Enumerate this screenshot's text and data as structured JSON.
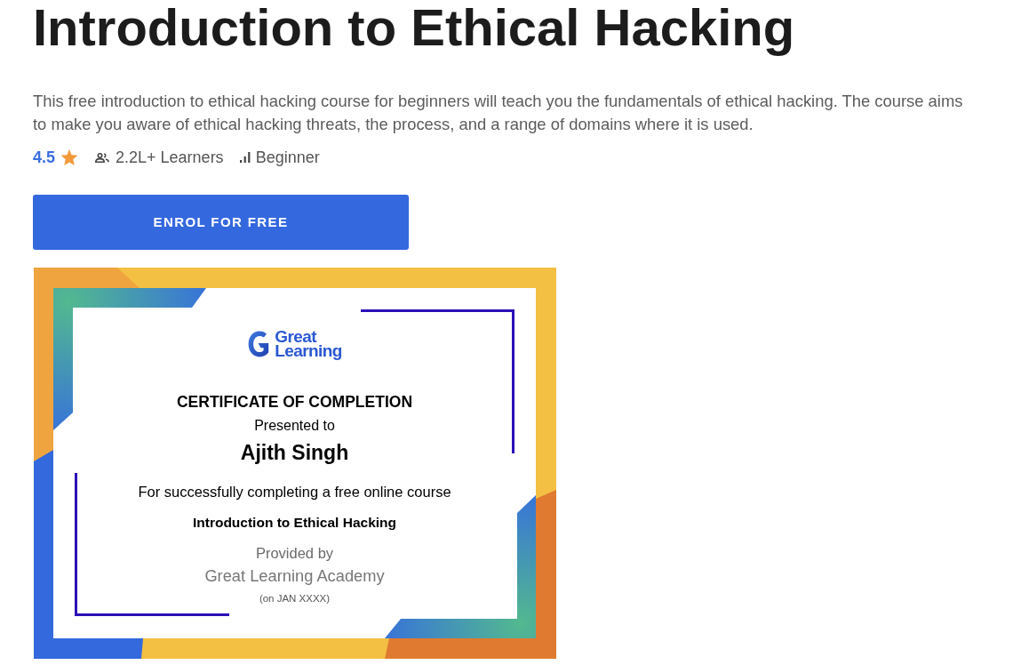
{
  "course": {
    "title": "Introduction to Ethical Hacking",
    "description": "This free introduction to ethical hacking course for beginners will teach you the fundamentals of ethical hacking. The course aims to make you aware of ethical hacking threats, the process, and a range of domains where it is used.",
    "rating": "4.5",
    "learners": "2.2L+ Learners",
    "level": "Beginner"
  },
  "enrol_button": {
    "label": "ENROL FOR FREE"
  },
  "certificate": {
    "logo_lines": [
      "Great",
      "Learning"
    ],
    "heading": "CERTIFICATE OF COMPLETION",
    "presented_to": "Presented to",
    "recipient": "Ajith Singh",
    "statement": "For successfully completing a free online course",
    "course_name": "Introduction to Ethical Hacking",
    "provided_by": "Provided by",
    "provider": "Great Learning Academy",
    "date": "(on JAN XXXX)"
  }
}
